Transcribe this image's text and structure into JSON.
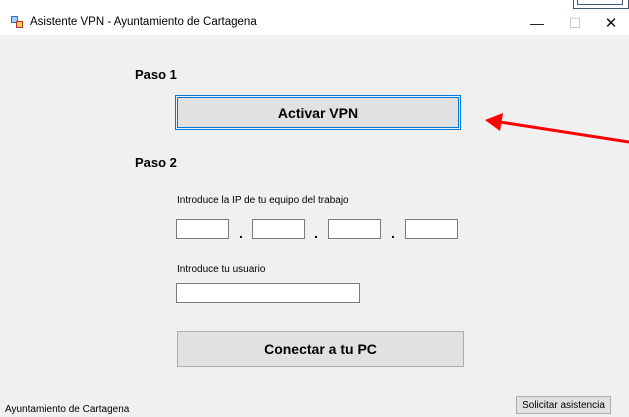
{
  "window": {
    "title": "Asistente VPN - Ayuntamiento de Cartagena",
    "minimize_glyph": "—",
    "maximize_glyph": "☐",
    "close_glyph": "✕"
  },
  "step1": {
    "label": "Paso 1",
    "activate_button": "Activar VPN"
  },
  "step2": {
    "label": "Paso 2",
    "ip_label": "Introduce la IP de tu equipo del trabajo",
    "ip_octets": [
      "",
      "",
      "",
      ""
    ],
    "ip_separator": ".",
    "user_label": "Introduce tu usuario",
    "user_value": "",
    "connect_button": "Conectar a tu PC"
  },
  "footer": {
    "org_text": "Ayuntamiento de Cartagena",
    "assist_button": "Solicitar asistencia"
  },
  "annotation": {
    "arrow_color": "#ff0000",
    "arrow_target": "activate-vpn-button"
  },
  "colors": {
    "focus_border": "#0078d7",
    "button_face": "#e1e1e1",
    "window_bg": "#f0f0f0"
  }
}
